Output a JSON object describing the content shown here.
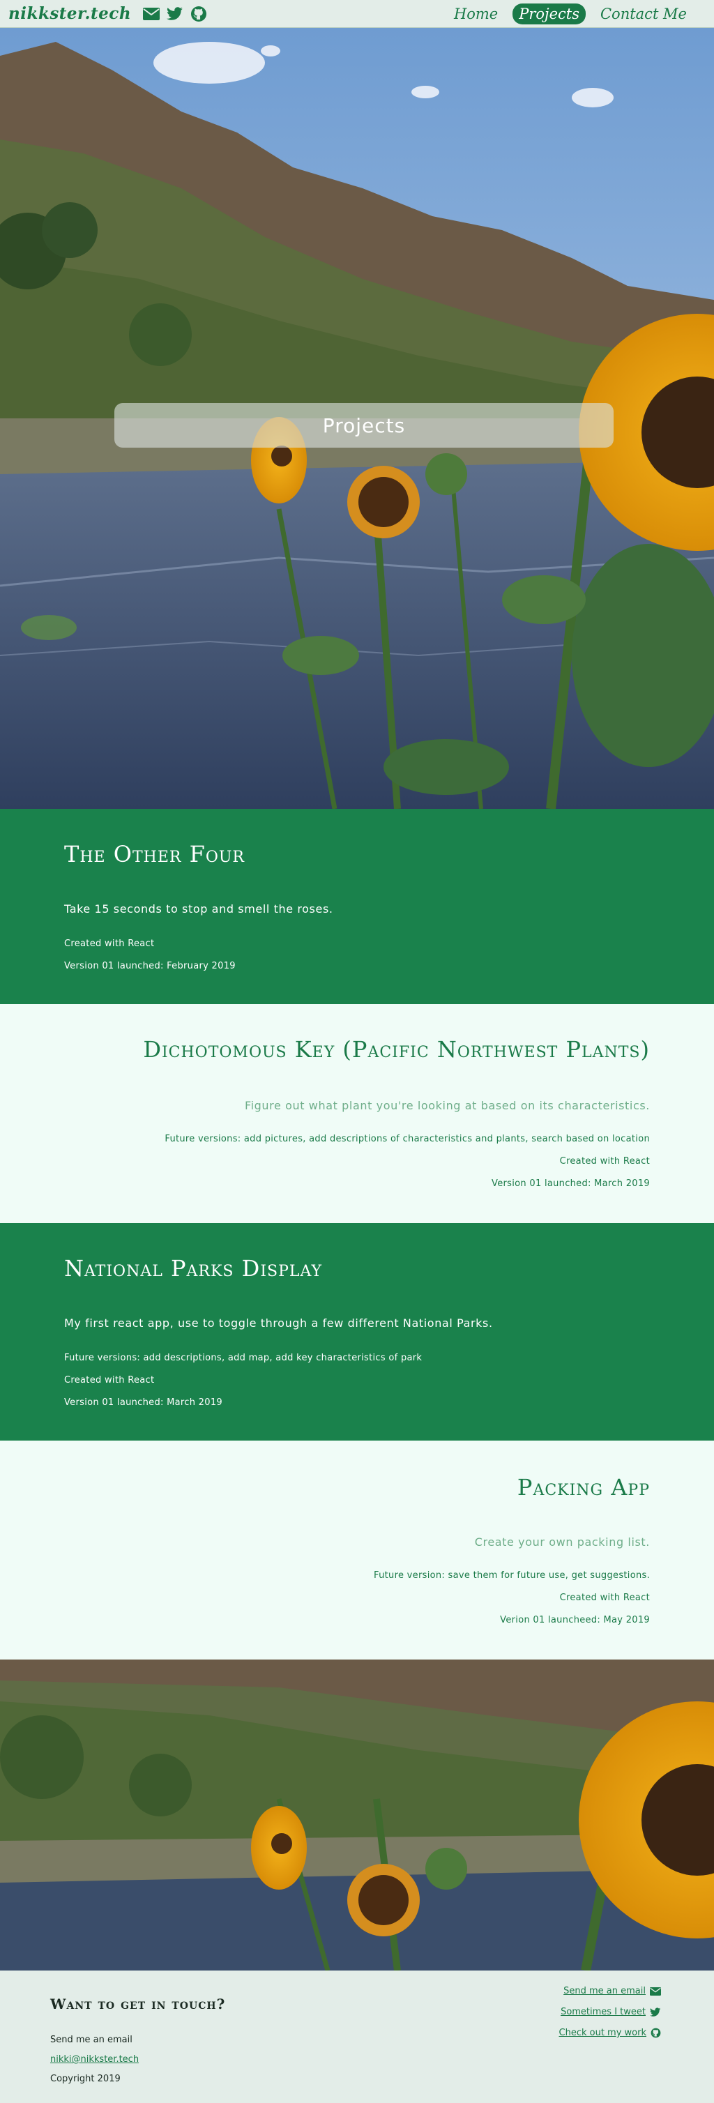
{
  "navbar": {
    "brand": "nikkster.tech",
    "icons": [
      "envelope-icon",
      "twitter-icon",
      "github-icon"
    ],
    "links": [
      "Home",
      "Projects",
      "Contact Me"
    ],
    "active_link": "Projects"
  },
  "hero": {
    "title": "Projects"
  },
  "projects": [
    {
      "title": "The Other Four",
      "description": "Take 15 seconds to stop and smell the roses.",
      "lines": [
        "Created with React",
        "Version 01 launched: February 2019"
      ]
    },
    {
      "title": "Dichotomous Key (Pacific Northwest Plants)",
      "description": "Figure out what plant you're looking at based on its characteristics.",
      "lines": [
        "Future versions: add pictures, add descriptions of characteristics and plants, search based on location",
        "Created with React",
        "Version 01 launched: March 2019"
      ]
    },
    {
      "title": "National Parks Display",
      "description": "My first react app, use to toggle through a few different National Parks.",
      "lines": [
        "Future versions: add descriptions, add map, add key characteristics of park",
        "Created with React",
        "Version 01 launched: March 2019"
      ]
    },
    {
      "title": "Packing App",
      "description": "Create your own packing list.",
      "lines": [
        "Future version: save them for future use, get suggestions.",
        "Created with React",
        "Verion 01 launcheed: May 2019"
      ]
    }
  ],
  "footer": {
    "title": "Want to get in touch?",
    "send_email_label": "Send me an email",
    "email": "nikki@nikkster.tech",
    "copyright": "Copyright 2019",
    "links": [
      {
        "label": "Send me an email",
        "icon": "envelope-icon"
      },
      {
        "label": "Sometimes I tweet",
        "icon": "twitter-icon"
      },
      {
        "label": "Check out my work",
        "icon": "github-icon"
      }
    ]
  },
  "colors": {
    "brand_green": "#1a824c",
    "light_bg": "#f0fcf7",
    "nav_bg": "#e3ede8"
  }
}
